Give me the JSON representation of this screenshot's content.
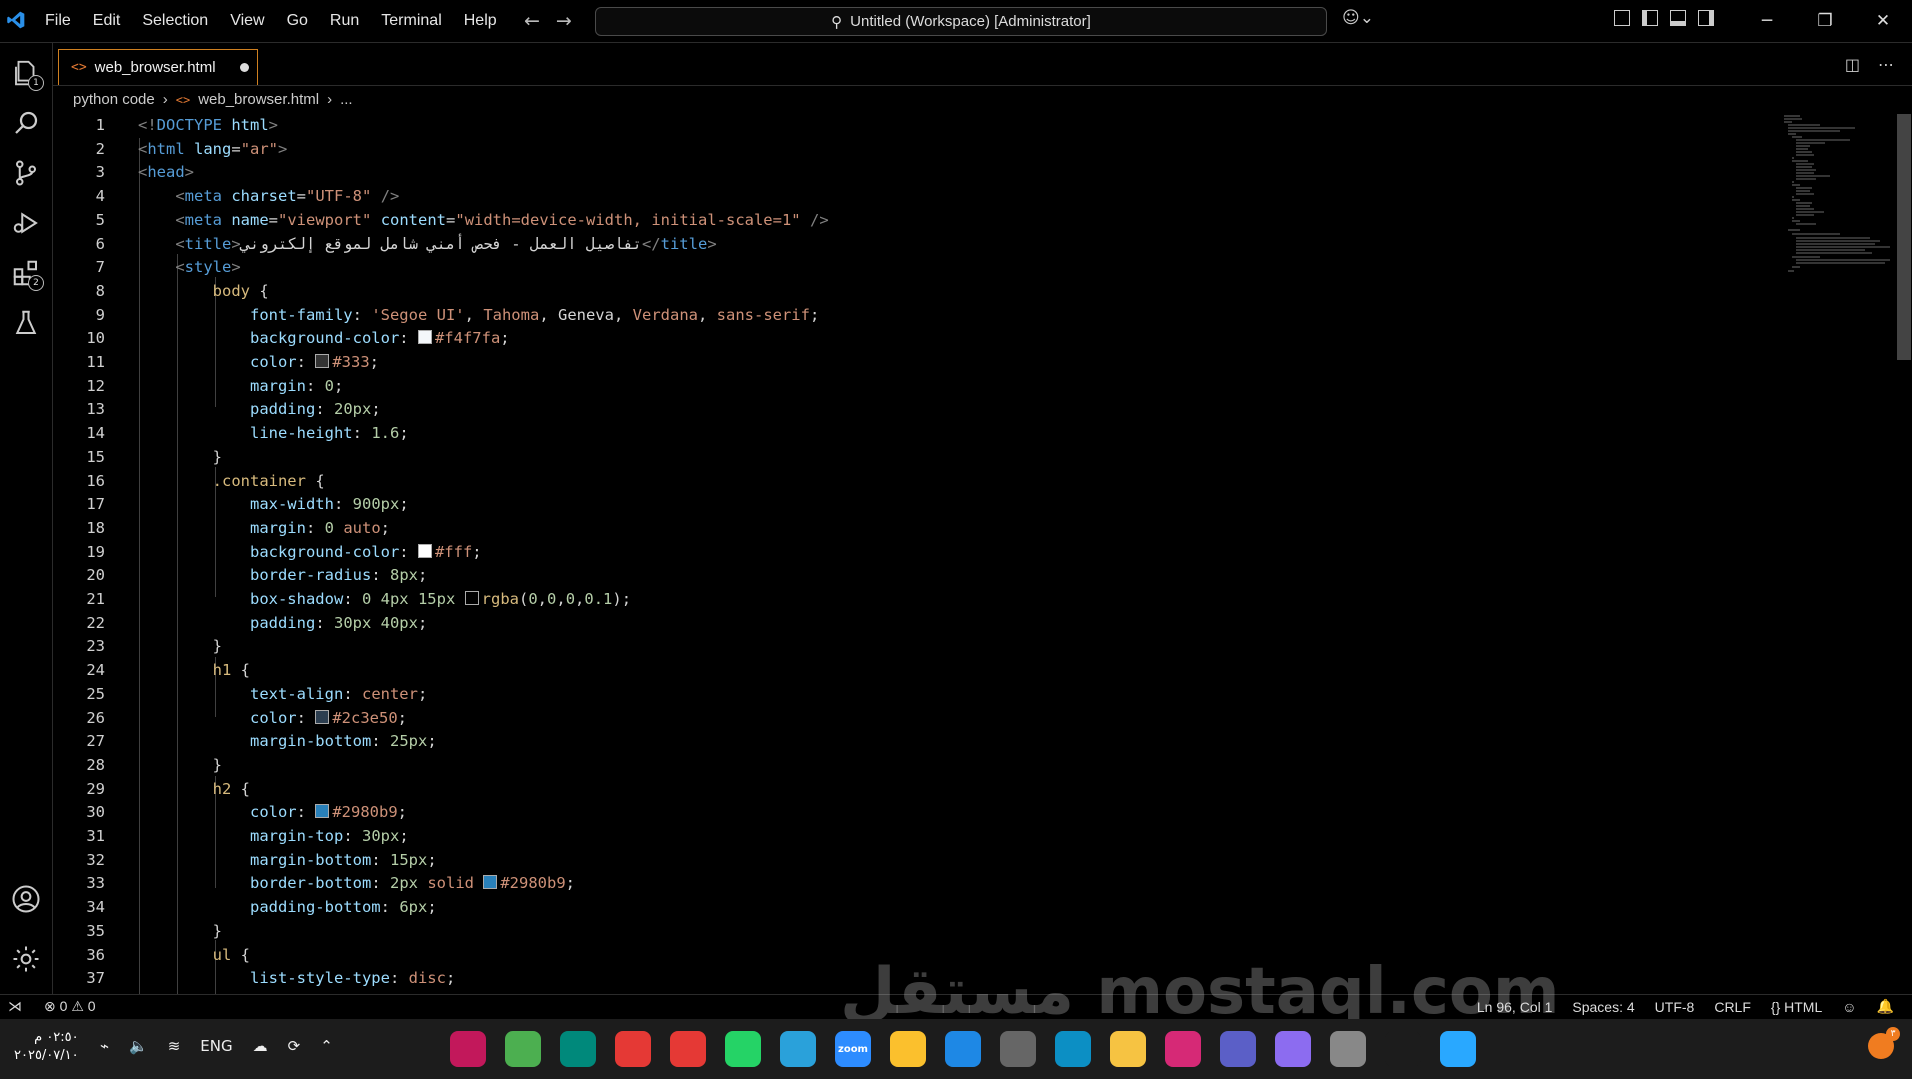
{
  "menu": [
    "File",
    "Edit",
    "Selection",
    "View",
    "Go",
    "Run",
    "Terminal",
    "Help"
  ],
  "command_center": "Untitled (Workspace) [Administrator]",
  "activity_badges": {
    "explorer": "1",
    "extensions": "2"
  },
  "tab": {
    "filename": "web_browser.html"
  },
  "breadcrumb": {
    "folder": "python code",
    "file": "web_browser.html",
    "more": "..."
  },
  "code_lines": [
    [
      [
        "t-br",
        "<!"
      ],
      [
        "t-tag",
        "DOCTYPE"
      ],
      [
        "t-plain",
        " "
      ],
      [
        "t-attr",
        "html"
      ],
      [
        "t-br",
        ">"
      ]
    ],
    [
      [
        "t-br",
        "<"
      ],
      [
        "t-tag",
        "html"
      ],
      [
        "t-plain",
        " "
      ],
      [
        "t-attr",
        "lang"
      ],
      [
        "t-plain",
        "="
      ],
      [
        "t-str",
        "\"ar\""
      ],
      [
        "t-br",
        ">"
      ]
    ],
    [
      [
        "t-br",
        "<"
      ],
      [
        "t-tag",
        "head"
      ],
      [
        "t-br",
        ">"
      ]
    ],
    [
      [
        "t-plain",
        "    "
      ],
      [
        "t-br",
        "<"
      ],
      [
        "t-tag",
        "meta"
      ],
      [
        "t-plain",
        " "
      ],
      [
        "t-attr",
        "charset"
      ],
      [
        "t-plain",
        "="
      ],
      [
        "t-str",
        "\"UTF-8\""
      ],
      [
        "t-plain",
        " "
      ],
      [
        "t-br",
        "/>"
      ]
    ],
    [
      [
        "t-plain",
        "    "
      ],
      [
        "t-br",
        "<"
      ],
      [
        "t-tag",
        "meta"
      ],
      [
        "t-plain",
        " "
      ],
      [
        "t-attr",
        "name"
      ],
      [
        "t-plain",
        "="
      ],
      [
        "t-str",
        "\"viewport\""
      ],
      [
        "t-plain",
        " "
      ],
      [
        "t-attr",
        "content"
      ],
      [
        "t-plain",
        "="
      ],
      [
        "t-str",
        "\"width=device-width, initial-scale=1\""
      ],
      [
        "t-plain",
        " "
      ],
      [
        "t-br",
        "/>"
      ]
    ],
    [
      [
        "t-plain",
        "    "
      ],
      [
        "t-br",
        "<"
      ],
      [
        "t-tag",
        "title"
      ],
      [
        "t-br",
        ">"
      ],
      [
        "t-txt",
        "تفاصيل العمل - فحص أمني شامل لموقع إلكتروني"
      ],
      [
        "t-br",
        "</"
      ],
      [
        "t-tag",
        "title"
      ],
      [
        "t-br",
        ">"
      ]
    ],
    [
      [
        "t-plain",
        "    "
      ],
      [
        "t-br",
        "<"
      ],
      [
        "t-tag",
        "style"
      ],
      [
        "t-br",
        ">"
      ]
    ],
    [
      [
        "t-plain",
        "        "
      ],
      [
        "t-sel",
        "body"
      ],
      [
        "t-plain",
        " {"
      ]
    ],
    [
      [
        "t-plain",
        "            "
      ],
      [
        "t-prop",
        "font-family"
      ],
      [
        "t-plain",
        ": "
      ],
      [
        "t-str",
        "'Segoe UI'"
      ],
      [
        "t-plain",
        ", "
      ],
      [
        "t-str",
        "Tahoma"
      ],
      [
        "t-plain",
        ", "
      ],
      [
        "t-plain",
        "Geneva"
      ],
      [
        "t-plain",
        ", "
      ],
      [
        "t-str",
        "Verdana"
      ],
      [
        "t-plain",
        ", "
      ],
      [
        "t-str",
        "sans-serif"
      ],
      [
        "t-plain",
        ";"
      ]
    ],
    [
      [
        "t-plain",
        "            "
      ],
      [
        "t-prop",
        "background-color"
      ],
      [
        "t-plain",
        ": "
      ],
      [
        "sw",
        "#f4f7fa"
      ],
      [
        "t-str",
        "#f4f7fa"
      ],
      [
        "t-plain",
        ";"
      ]
    ],
    [
      [
        "t-plain",
        "            "
      ],
      [
        "t-prop",
        "color"
      ],
      [
        "t-plain",
        ": "
      ],
      [
        "sw",
        "#333"
      ],
      [
        "t-str",
        "#333"
      ],
      [
        "t-plain",
        ";"
      ]
    ],
    [
      [
        "t-plain",
        "            "
      ],
      [
        "t-prop",
        "margin"
      ],
      [
        "t-plain",
        ": "
      ],
      [
        "t-num",
        "0"
      ],
      [
        "t-plain",
        ";"
      ]
    ],
    [
      [
        "t-plain",
        "            "
      ],
      [
        "t-prop",
        "padding"
      ],
      [
        "t-plain",
        ": "
      ],
      [
        "t-num",
        "20px"
      ],
      [
        "t-plain",
        ";"
      ]
    ],
    [
      [
        "t-plain",
        "            "
      ],
      [
        "t-prop",
        "line-height"
      ],
      [
        "t-plain",
        ": "
      ],
      [
        "t-num",
        "1.6"
      ],
      [
        "t-plain",
        ";"
      ]
    ],
    [
      [
        "t-plain",
        "        }"
      ]
    ],
    [
      [
        "t-plain",
        "        "
      ],
      [
        "t-sel",
        ".container"
      ],
      [
        "t-plain",
        " {"
      ]
    ],
    [
      [
        "t-plain",
        "            "
      ],
      [
        "t-prop",
        "max-width"
      ],
      [
        "t-plain",
        ": "
      ],
      [
        "t-num",
        "900px"
      ],
      [
        "t-plain",
        ";"
      ]
    ],
    [
      [
        "t-plain",
        "            "
      ],
      [
        "t-prop",
        "margin"
      ],
      [
        "t-plain",
        ": "
      ],
      [
        "t-num",
        "0"
      ],
      [
        "t-plain",
        " "
      ],
      [
        "t-str",
        "auto"
      ],
      [
        "t-plain",
        ";"
      ]
    ],
    [
      [
        "t-plain",
        "            "
      ],
      [
        "t-prop",
        "background-color"
      ],
      [
        "t-plain",
        ": "
      ],
      [
        "sw",
        "#fff"
      ],
      [
        "t-str",
        "#fff"
      ],
      [
        "t-plain",
        ";"
      ]
    ],
    [
      [
        "t-plain",
        "            "
      ],
      [
        "t-prop",
        "border-radius"
      ],
      [
        "t-plain",
        ": "
      ],
      [
        "t-num",
        "8px"
      ],
      [
        "t-plain",
        ";"
      ]
    ],
    [
      [
        "t-plain",
        "            "
      ],
      [
        "t-prop",
        "box-shadow"
      ],
      [
        "t-plain",
        ": "
      ],
      [
        "t-num",
        "0 4px 15px"
      ],
      [
        "t-plain",
        " "
      ],
      [
        "sw",
        "rgba(0,0,0,0.1)"
      ],
      [
        "t-sel",
        "rgba"
      ],
      [
        "t-plain",
        "("
      ],
      [
        "t-num",
        "0"
      ],
      [
        "t-plain",
        ","
      ],
      [
        "t-num",
        "0"
      ],
      [
        "t-plain",
        ","
      ],
      [
        "t-num",
        "0"
      ],
      [
        "t-plain",
        ","
      ],
      [
        "t-num",
        "0.1"
      ],
      [
        "t-plain",
        ");"
      ]
    ],
    [
      [
        "t-plain",
        "            "
      ],
      [
        "t-prop",
        "padding"
      ],
      [
        "t-plain",
        ": "
      ],
      [
        "t-num",
        "30px 40px"
      ],
      [
        "t-plain",
        ";"
      ]
    ],
    [
      [
        "t-plain",
        "        }"
      ]
    ],
    [
      [
        "t-plain",
        "        "
      ],
      [
        "t-sel",
        "h1"
      ],
      [
        "t-plain",
        " {"
      ]
    ],
    [
      [
        "t-plain",
        "            "
      ],
      [
        "t-prop",
        "text-align"
      ],
      [
        "t-plain",
        ": "
      ],
      [
        "t-str",
        "center"
      ],
      [
        "t-plain",
        ";"
      ]
    ],
    [
      [
        "t-plain",
        "            "
      ],
      [
        "t-prop",
        "color"
      ],
      [
        "t-plain",
        ": "
      ],
      [
        "sw",
        "#2c3e50"
      ],
      [
        "t-str",
        "#2c3e50"
      ],
      [
        "t-plain",
        ";"
      ]
    ],
    [
      [
        "t-plain",
        "            "
      ],
      [
        "t-prop",
        "margin-bottom"
      ],
      [
        "t-plain",
        ": "
      ],
      [
        "t-num",
        "25px"
      ],
      [
        "t-plain",
        ";"
      ]
    ],
    [
      [
        "t-plain",
        "        }"
      ]
    ],
    [
      [
        "t-plain",
        "        "
      ],
      [
        "t-sel",
        "h2"
      ],
      [
        "t-plain",
        " {"
      ]
    ],
    [
      [
        "t-plain",
        "            "
      ],
      [
        "t-prop",
        "color"
      ],
      [
        "t-plain",
        ": "
      ],
      [
        "sw",
        "#2980b9"
      ],
      [
        "t-str",
        "#2980b9"
      ],
      [
        "t-plain",
        ";"
      ]
    ],
    [
      [
        "t-plain",
        "            "
      ],
      [
        "t-prop",
        "margin-top"
      ],
      [
        "t-plain",
        ": "
      ],
      [
        "t-num",
        "30px"
      ],
      [
        "t-plain",
        ";"
      ]
    ],
    [
      [
        "t-plain",
        "            "
      ],
      [
        "t-prop",
        "margin-bottom"
      ],
      [
        "t-plain",
        ": "
      ],
      [
        "t-num",
        "15px"
      ],
      [
        "t-plain",
        ";"
      ]
    ],
    [
      [
        "t-plain",
        "            "
      ],
      [
        "t-prop",
        "border-bottom"
      ],
      [
        "t-plain",
        ": "
      ],
      [
        "t-num",
        "2px"
      ],
      [
        "t-plain",
        " "
      ],
      [
        "t-str",
        "solid"
      ],
      [
        "t-plain",
        " "
      ],
      [
        "sw",
        "#2980b9"
      ],
      [
        "t-str",
        "#2980b9"
      ],
      [
        "t-plain",
        ";"
      ]
    ],
    [
      [
        "t-plain",
        "            "
      ],
      [
        "t-prop",
        "padding-bottom"
      ],
      [
        "t-plain",
        ": "
      ],
      [
        "t-num",
        "6px"
      ],
      [
        "t-plain",
        ";"
      ]
    ],
    [
      [
        "t-plain",
        "        }"
      ]
    ],
    [
      [
        "t-plain",
        "        "
      ],
      [
        "t-sel",
        "ul"
      ],
      [
        "t-plain",
        " {"
      ]
    ],
    [
      [
        "t-plain",
        "            "
      ],
      [
        "t-prop",
        "list-style-type"
      ],
      [
        "t-plain",
        ": "
      ],
      [
        "t-str",
        "disc"
      ],
      [
        "t-plain",
        ";"
      ]
    ]
  ],
  "status": {
    "errors": "0",
    "warnings": "0",
    "position": "Ln 96, Col 1",
    "spaces": "Spaces: 4",
    "encoding": "UTF-8",
    "eol": "CRLF",
    "language": "HTML"
  },
  "taskbar": {
    "time": "٠٢:٥٠ م",
    "date": "٢٠٢٥/٠٧/١٠",
    "lang": "ENG",
    "apps": [
      {
        "name": "app-icon",
        "color": "#c2185b"
      },
      {
        "name": "bluestacks-icon",
        "color": "#4caf50"
      },
      {
        "name": "visual-studio-icon",
        "color": "#00897b"
      },
      {
        "name": "youtube-icon",
        "color": "#e53935"
      },
      {
        "name": "wps-icon",
        "color": "#e53935"
      },
      {
        "name": "whatsapp-icon",
        "color": "#25d366"
      },
      {
        "name": "telegram-icon",
        "color": "#2aa1da"
      },
      {
        "name": "zoom-icon",
        "color": "#2d8cff",
        "label": "zoom"
      },
      {
        "name": "chrome-icon",
        "color": "#fbc02d"
      },
      {
        "name": "vscode-icon",
        "color": "#1e88e5"
      },
      {
        "name": "store-icon",
        "color": "#666"
      },
      {
        "name": "edge-icon",
        "color": "#0c8fc4"
      },
      {
        "name": "files-icon",
        "color": "#f6c342"
      },
      {
        "name": "instagram-icon",
        "color": "#d62976"
      },
      {
        "name": "teams-icon",
        "color": "#5b5fc7"
      },
      {
        "name": "copilot-icon",
        "color": "#8c6cf0"
      },
      {
        "name": "task-view-icon",
        "color": "#888"
      },
      {
        "name": "search-icon",
        "color": "#1c1c1c"
      },
      {
        "name": "start-icon",
        "color": "#29a8ff"
      }
    ],
    "notification_badge": "٣"
  },
  "watermark": "مستقل mostaql.com"
}
